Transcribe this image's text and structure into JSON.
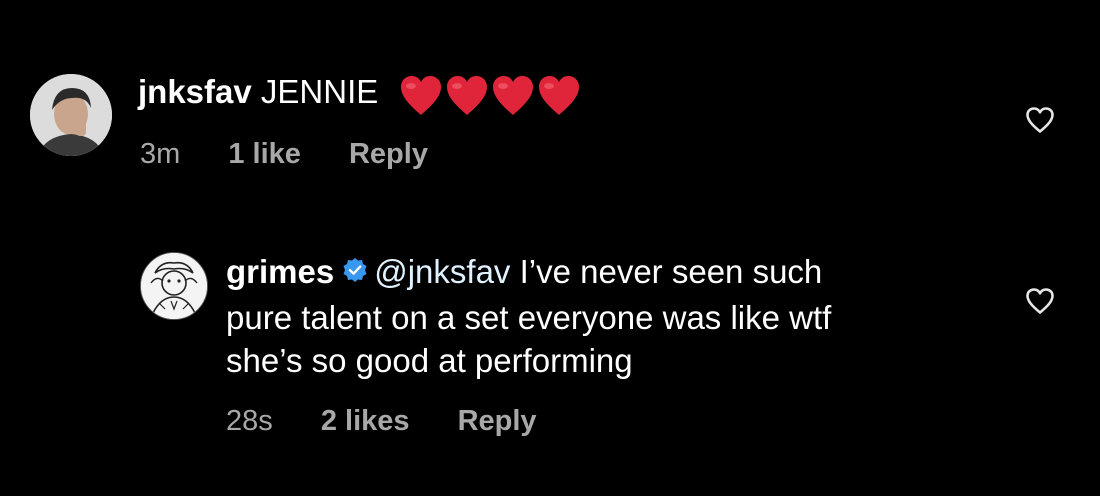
{
  "comments": [
    {
      "username": "jnksfav",
      "text": "JENNIE",
      "emoji": [
        "heart-emoji",
        "heart-emoji",
        "heart-emoji",
        "heart-emoji"
      ],
      "time": "3m",
      "likes": "1 like",
      "reply_label": "Reply",
      "avatar": "user-avatar-photo"
    },
    {
      "username": "grimes",
      "verified": true,
      "mention": "@jnksfav",
      "text_line1": " I’ve never seen such",
      "text_line2": "pure talent on a set everyone was like wtf",
      "text_line3": "she’s so good at performing",
      "time": "28s",
      "likes": "2 likes",
      "reply_label": "Reply",
      "avatar": "illustrated-avatar"
    }
  ],
  "colors": {
    "background": "#000000",
    "primary_text": "#ffffff",
    "meta_text": "#a8a8a8",
    "heart_emoji": "#e0253a",
    "verified_badge": "#3897f0"
  },
  "icons": [
    "heart-outline-icon",
    "verified-badge-icon"
  ]
}
